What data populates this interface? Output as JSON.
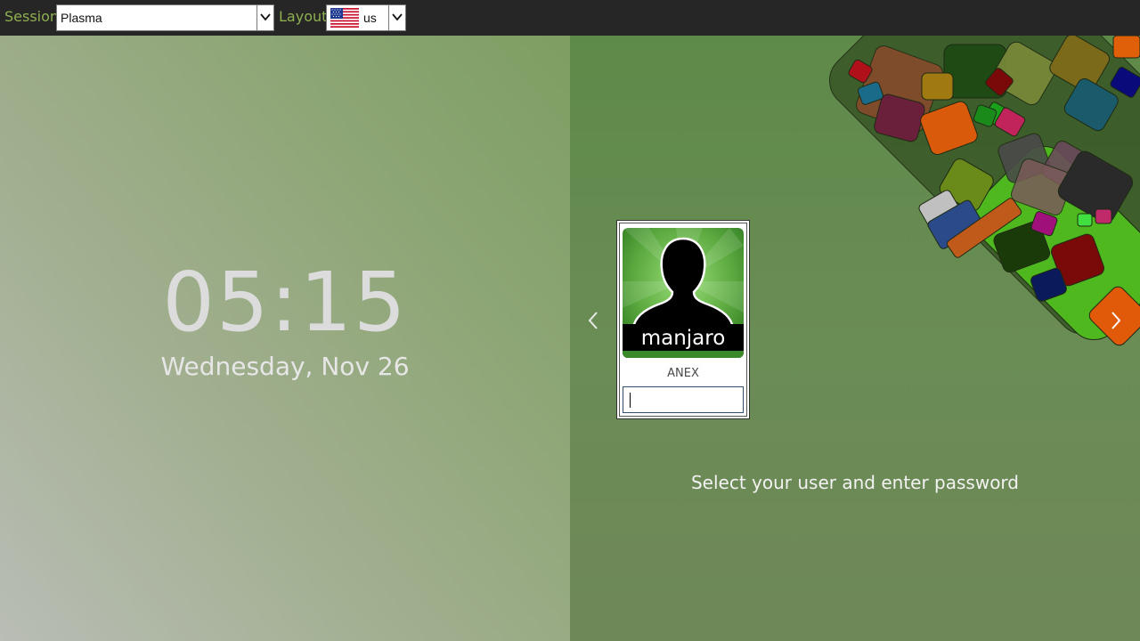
{
  "topbar": {
    "session_label": "Session",
    "session_value": "Plasma",
    "layout_label": "Layout",
    "layout_value": "us",
    "layout_flag_icon": "us-flag-icon"
  },
  "clock": {
    "time": "05:15",
    "date": "Wednesday, Nov 26"
  },
  "login": {
    "avatar_brand": "manjaro",
    "username": "ANEX",
    "password_value": "",
    "prompt": "Select your user and enter password",
    "prev_icon": "chevron-left-icon",
    "next_icon": "chevron-right-icon"
  },
  "colors": {
    "topbar_bg": "#262626",
    "label_color": "#8faf4f",
    "right_panel_bg": "#6a8c55"
  }
}
